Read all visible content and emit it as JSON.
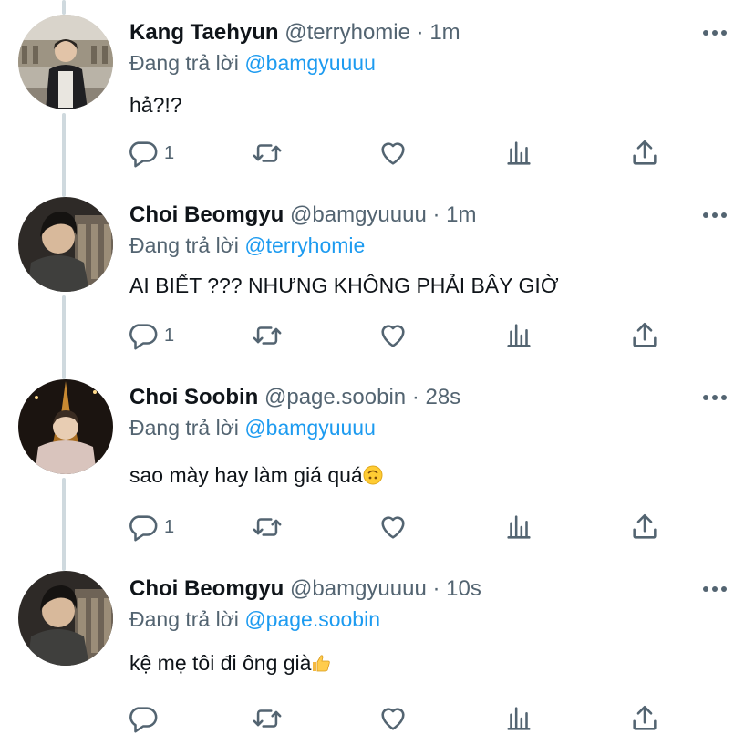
{
  "colors": {
    "accent": "#1d9bf0",
    "secondary_text": "#536471",
    "icon": "#536471",
    "thread_line": "#cfd9de"
  },
  "reply_prefix": "Đang trả lời",
  "tweets": [
    {
      "name": "Kang Taehyun",
      "handle": "@terryhomie",
      "dot": "·",
      "time": "1m",
      "reply_to": "@bamgyuuuu",
      "text": "hả?!?",
      "reply_count": "1",
      "avatar_icon": "person-photo"
    },
    {
      "name": "Choi Beomgyu",
      "handle": "@bamgyuuuu",
      "dot": "·",
      "time": "1m",
      "reply_to": "@terryhomie",
      "text": "AI BIẾT ??? NHƯNG KHÔNG PHẢI BÂY GIỜ",
      "reply_count": "1",
      "avatar_icon": "person-photo"
    },
    {
      "name": "Choi Soobin",
      "handle": "@page.soobin",
      "dot": "·",
      "time": "28s",
      "reply_to": "@bamgyuuuu",
      "text": "sao mày hay làm giá quá",
      "emoji": "upside-down-face",
      "reply_count": "1",
      "avatar_icon": "person-photo-eiffel"
    },
    {
      "name": "Choi Beomgyu",
      "handle": "@bamgyuuuu",
      "dot": "·",
      "time": "10s",
      "reply_to": "@page.soobin",
      "text": "kệ mẹ tôi đi ông già",
      "emoji": "thumbs-up",
      "reply_count": "",
      "avatar_icon": "person-photo"
    }
  ],
  "action_icons": [
    "reply-icon",
    "retweet-icon",
    "like-icon",
    "analytics-icon",
    "share-icon"
  ]
}
